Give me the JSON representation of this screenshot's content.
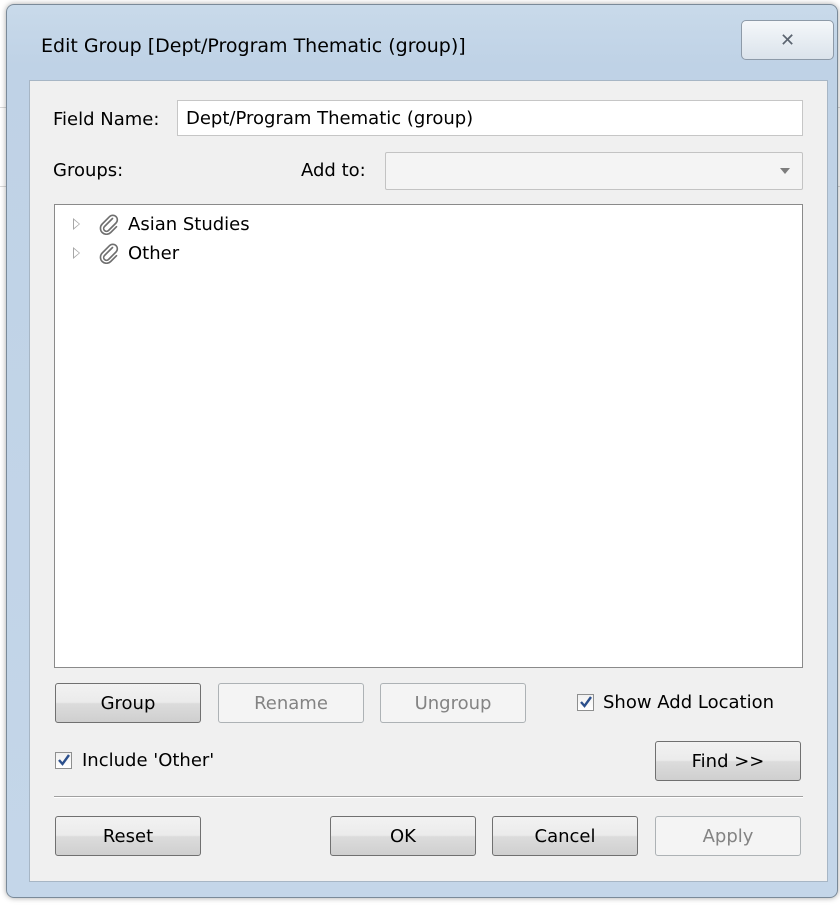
{
  "dialog": {
    "title": "Edit Group [Dept/Program Thematic (group)]",
    "close_glyph": "✕"
  },
  "field_name": {
    "label": "Field Name:",
    "value": "Dept/Program Thematic (group)"
  },
  "groups": {
    "label": "Groups:"
  },
  "add_to": {
    "label": "Add to:",
    "value": ""
  },
  "tree": {
    "items": [
      {
        "label": "Asian Studies",
        "icon": "paperclip-icon",
        "expanded": false
      },
      {
        "label": "Other",
        "icon": "paperclip-icon",
        "expanded": false
      }
    ]
  },
  "buttons": {
    "group": "Group",
    "rename": "Rename",
    "ungroup": "Ungroup",
    "find": "Find >>",
    "reset": "Reset",
    "ok": "OK",
    "cancel": "Cancel",
    "apply": "Apply"
  },
  "checkboxes": {
    "show_add_location": {
      "label": "Show Add Location",
      "checked": true
    },
    "include_other": {
      "label": "Include 'Other'",
      "checked": true
    }
  },
  "colors": {
    "window_frame": "#bfd2e6",
    "check": "#2b4f8c"
  }
}
